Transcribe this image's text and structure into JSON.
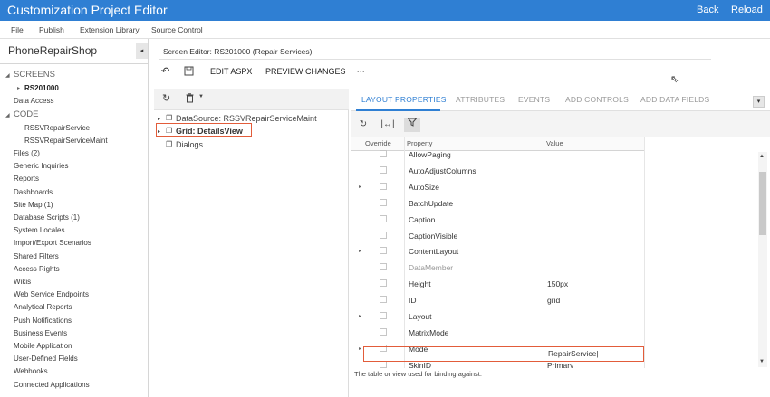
{
  "app": {
    "title": "Customization Project Editor",
    "back": "Back",
    "reload": "Reload"
  },
  "menu": [
    "File",
    "Publish",
    "Extension Library",
    "Source Control"
  ],
  "sidebar": {
    "project": "PhoneRepairShop",
    "screens_header": "SCREENS",
    "screen_item": "RS201000",
    "data_access": "Data Access",
    "code_header": "CODE",
    "code_items": [
      "RSSVRepairService",
      "RSSVRepairServiceMaint"
    ],
    "items": [
      "Files (2)",
      "Generic Inquiries",
      "Reports",
      "Dashboards",
      "Site Map (1)",
      "Database Scripts (1)",
      "System Locales",
      "Import/Export Scenarios",
      "Shared Filters",
      "Access Rights",
      "Wikis",
      "Web Service Endpoints",
      "Analytical Reports",
      "Push Notifications",
      "Business Events",
      "Mobile Application",
      "User-Defined Fields",
      "Webhooks",
      "Connected Applications"
    ]
  },
  "editor": {
    "breadcrumb": "Screen Editor: RS201000 (Repair Services)",
    "edit_aspx": "EDIT ASPX",
    "preview": "PREVIEW CHANGES",
    "more": "···"
  },
  "tree": {
    "datasource": "DataSource: RSSVRepairServiceMaint",
    "grid": "Grid: DetailsView",
    "dialogs": "Dialogs"
  },
  "tabs": [
    "LAYOUT PROPERTIES",
    "ATTRIBUTES",
    "EVENTS",
    "ADD CONTROLS",
    "ADD DATA FIELDS"
  ],
  "table": {
    "headers": {
      "override": "Override",
      "property": "Property",
      "value": "Value"
    },
    "rows": [
      {
        "name": "AllowPaging",
        "value": "",
        "expandable": false
      },
      {
        "name": "AutoAdjustColumns",
        "value": "",
        "expandable": false
      },
      {
        "name": "AutoSize",
        "value": "",
        "expandable": true
      },
      {
        "name": "BatchUpdate",
        "value": "",
        "expandable": false
      },
      {
        "name": "Caption",
        "value": "",
        "expandable": false
      },
      {
        "name": "CaptionVisible",
        "value": "",
        "expandable": false
      },
      {
        "name": "ContentLayout",
        "value": "",
        "expandable": true
      },
      {
        "name": "DataMember",
        "value": "RepairService",
        "expandable": false
      },
      {
        "name": "Height",
        "value": "150px",
        "expandable": false
      },
      {
        "name": "ID",
        "value": "grid",
        "expandable": false
      },
      {
        "name": "Layout",
        "value": "",
        "expandable": true
      },
      {
        "name": "MatrixMode",
        "value": "",
        "expandable": false
      },
      {
        "name": "Mode",
        "value": "",
        "expandable": true
      },
      {
        "name": "SkinID",
        "value": "Primary",
        "expandable": false
      }
    ],
    "description": "The table or view used for binding against."
  },
  "colors": {
    "accent": "#2f7fd3",
    "highlight": "#e25c3a"
  }
}
